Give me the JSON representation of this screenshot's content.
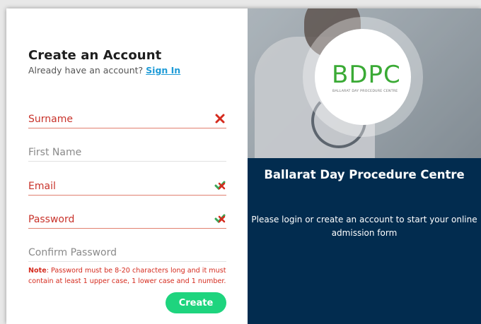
{
  "form": {
    "title": "Create an Account",
    "signin_prompt": "Already have an account?",
    "signin_link": "Sign In",
    "fields": {
      "surname": {
        "placeholder": "Surname",
        "value": "",
        "state": "error",
        "status_icon": "red-x-icon"
      },
      "first_name": {
        "placeholder": "First Name",
        "value": "",
        "state": "normal"
      },
      "email": {
        "placeholder": "Email",
        "value": "",
        "state": "error",
        "status_icon": "green-red-check-icon"
      },
      "password": {
        "placeholder": "Password",
        "value": "",
        "state": "error",
        "status_icon": "green-red-check-icon"
      },
      "confirm_password": {
        "placeholder": "Confirm Password",
        "value": "",
        "state": "normal"
      }
    },
    "note_label": "Note",
    "note_text": ": Password must be 8-20 characters long and it must contain at least 1 upper case, 1 lower case and 1 number.",
    "create_button": "Create"
  },
  "brand": {
    "logo_text": "BDPC",
    "logo_subtitle": "BALLARAT DAY PROCEDURE CENTRE",
    "title": "Ballarat Day Procedure Centre",
    "description": "Please login or create an account to start your online admission form"
  },
  "colors": {
    "error": "#c8322a",
    "accent_button": "#1ed47e",
    "link": "#1e9bd7",
    "brand_panel": "#022c4f",
    "logo_green": "#3aaa35"
  }
}
